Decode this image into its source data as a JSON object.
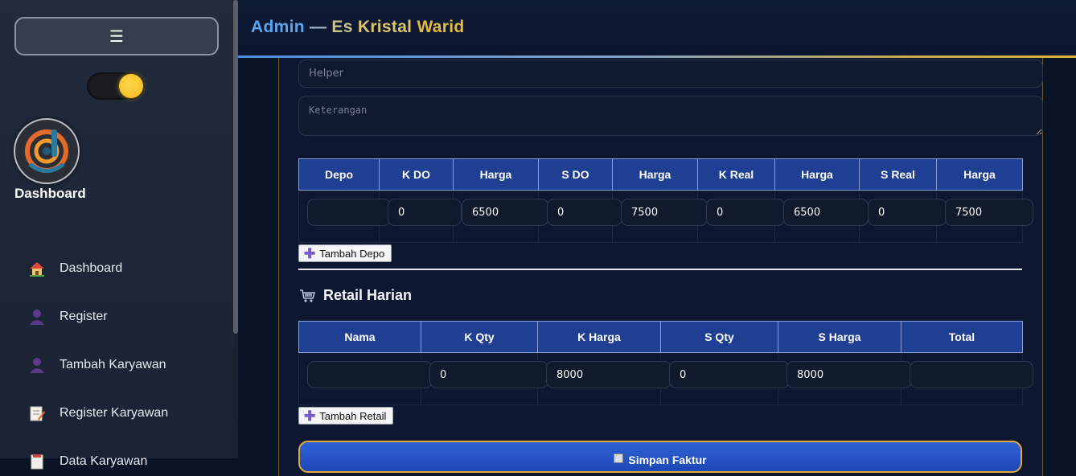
{
  "header": {
    "title_admin": "Admin",
    "title_sep": "—",
    "title_es": "Es",
    "title_kristal": "Kristal",
    "title_warid": "Warid"
  },
  "sidebar": {
    "menu_icon": "☰",
    "brand": "Dashboard",
    "theme_toggle": "on",
    "items": [
      {
        "label": "Dashboard",
        "icon": "house-icon"
      },
      {
        "label": "Register",
        "icon": "user-icon"
      },
      {
        "label": "Tambah Karyawan",
        "icon": "user-icon"
      },
      {
        "label": "Register Karyawan",
        "icon": "memo-icon"
      },
      {
        "label": "Data Karyawan",
        "icon": "document-icon"
      }
    ]
  },
  "form": {
    "helper_placeholder": "Helper",
    "keterangan_placeholder": "Keterangan"
  },
  "depo_table": {
    "headers": [
      "Depo",
      "K DO",
      "Harga",
      "S DO",
      "Harga",
      "K Real",
      "Harga",
      "S Real",
      "Harga"
    ],
    "row": [
      "",
      "0",
      "6500",
      "0",
      "7500",
      "0",
      "6500",
      "0",
      "7500"
    ],
    "add_button": "Tambah Depo"
  },
  "retail": {
    "section_title": "Retail Harian",
    "headers": [
      "Nama",
      "K Qty",
      "K Harga",
      "S Qty",
      "S Harga",
      "Total"
    ],
    "row": [
      "",
      "0",
      "8000",
      "0",
      "8000",
      ""
    ],
    "add_button": "Tambah Retail"
  },
  "save_button": "Simpan Faktur",
  "colors": {
    "accent_blue": "#1f3f93",
    "brand_gold": "#e8b93a",
    "toggle_knob": "#ffd84a"
  }
}
